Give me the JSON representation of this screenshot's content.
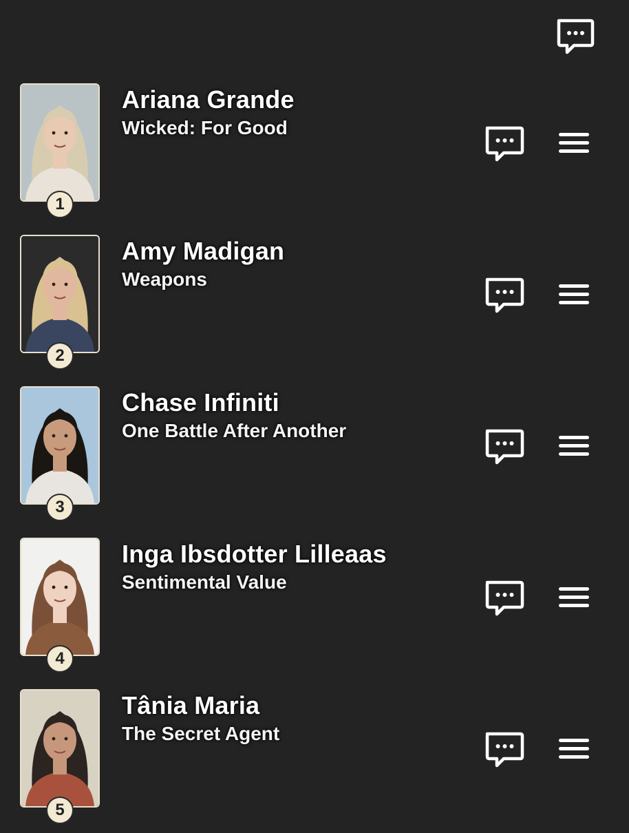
{
  "header": {
    "chat_icon": "chat-bubble-icon"
  },
  "actresses": [
    {
      "rank": "1",
      "name": "Ariana Grande",
      "film": "Wicked: For Good",
      "bg": "#b9c3c6",
      "hair": "#d8ccb0",
      "skin": "#e8c9b2",
      "cloth": "#e9e2d9"
    },
    {
      "rank": "2",
      "name": "Amy Madigan",
      "film": "Weapons",
      "bg": "#2b2b2b",
      "hair": "#d9c191",
      "skin": "#e2b79f",
      "cloth": "#3a4660"
    },
    {
      "rank": "3",
      "name": "Chase Infiniti",
      "film": "One Battle After Another",
      "bg": "#a9c6dd",
      "hair": "#1a1612",
      "skin": "#c99b7d",
      "cloth": "#e8e5e0"
    },
    {
      "rank": "4",
      "name": "Inga Ibsdotter Lilleaas",
      "film": "Sentimental Value",
      "bg": "#f1f1ef",
      "hair": "#7a5138",
      "skin": "#f0d2c0",
      "cloth": "#8b5b3d"
    },
    {
      "rank": "5",
      "name": "Tânia Maria",
      "film": "The Secret Agent",
      "bg": "#d8d2c2",
      "hair": "#2c2420",
      "skin": "#c7977c",
      "cloth": "#a8523d"
    }
  ],
  "colors": {
    "background": "#232323",
    "text": "#ffffff",
    "rank_badge": "#f3ead4",
    "thumb_border": "#e8e0cc"
  }
}
